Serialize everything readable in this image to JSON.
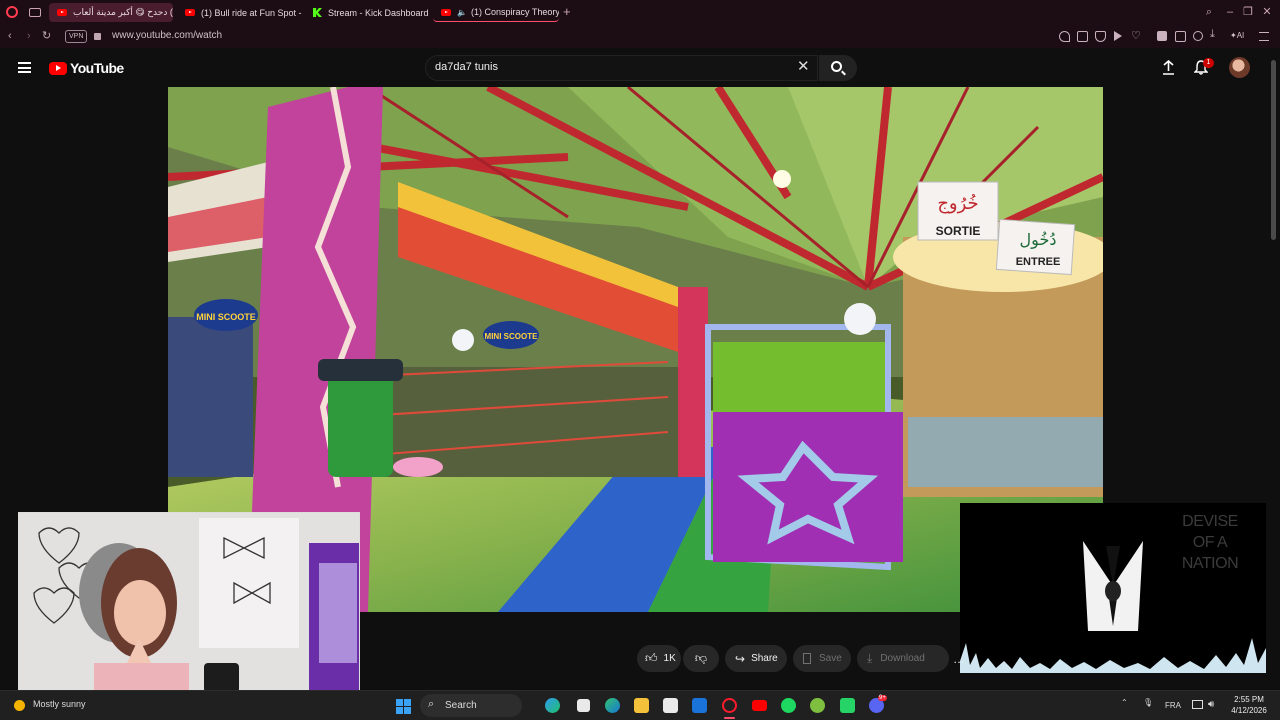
{
  "browser": {
    "tabs": [
      {
        "title": "(1) دحدح 😋 أكبر مدينة ألعاب",
        "active": true,
        "icon": "youtube-icon"
      },
      {
        "title": "(1) Bull ride at Fun Spot - Y",
        "active": false,
        "icon": "youtube-icon"
      },
      {
        "title": "Stream - Kick Dashboard",
        "active": false,
        "icon": "kick-icon"
      },
      {
        "title": "(1) Conspiracy Theory",
        "active": false,
        "icon": "youtube-icon"
      }
    ],
    "new_tab": "+",
    "vpn_label": "VPN",
    "url": "www.youtube.com/watch",
    "ai_label": "AI"
  },
  "youtube": {
    "logo_text": "YouTube",
    "search_value": "da7da7 tunis",
    "notification_count": "1"
  },
  "video": {
    "signs": {
      "exit_arabic": "خُرُوج",
      "exit_french": "SORTIE",
      "entry_arabic": "دُخُول",
      "entry_french": "ENTREE",
      "mini_scooter_left": "MINI SCOOTE",
      "mini_scooter_center": "MINI SCOOTE"
    }
  },
  "music_overlay": {
    "title": "DEVISE OF A NATION"
  },
  "actions": {
    "like_count": "1K",
    "share_label": "Share",
    "save_label": "Save",
    "download_label": "Download",
    "more": "…"
  },
  "taskbar": {
    "weather": "Mostly sunny",
    "search_label": "Search",
    "language": "FRA",
    "time": "2:55 PM",
    "date": "4/12/2026",
    "discord_badge": "9+"
  },
  "colors": {
    "youtube_red": "#ff0000",
    "browser_bg": "#1c0d14",
    "page_bg": "#0f0f0f",
    "kick_green": "#53fc18"
  }
}
